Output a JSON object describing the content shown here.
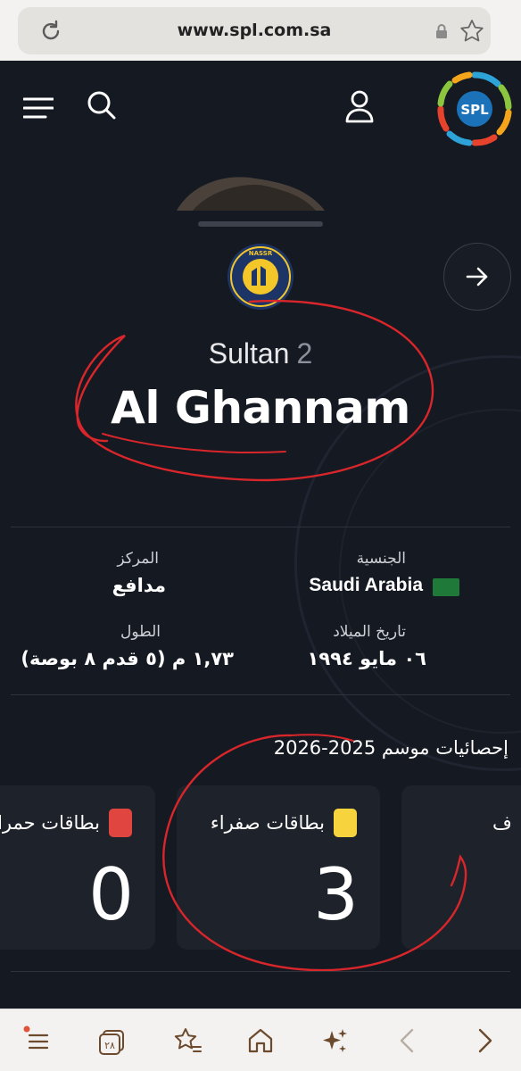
{
  "browser": {
    "url": "www.spl.com.sa"
  },
  "header": {
    "logo_text": "SPL"
  },
  "player": {
    "first_name": "Sultan",
    "shirt_number": "2",
    "last_name": "Al Ghannam"
  },
  "info": {
    "nationality_label": "الجنسية",
    "nationality_value": "Saudi Arabia",
    "position_label": "المركز",
    "position_value": "مدافع",
    "birthdate_label": "تاريخ الميلاد",
    "birthdate_value": "٠٦ مايو ١٩٩٤",
    "height_label": "الطول",
    "height_value": "١,٧٣ م (٥ قدم ٨ بوصة)"
  },
  "stats": {
    "title": "إحصائيات موسم 2025-2026",
    "cards": [
      {
        "label": "بطاقات حمراء",
        "value": "0",
        "chip_color": "#e0453f"
      },
      {
        "label": "بطاقات صفراء",
        "value": "3",
        "chip_color": "#f7d43e"
      },
      {
        "label": "ف",
        "value": ""
      }
    ]
  },
  "colors": {
    "background": "#151922",
    "annotation_red": "#d8262b",
    "club_yellow": "#f3c72a",
    "club_navy": "#1d3566"
  },
  "bottom_nav": {
    "tabs_count": "٢٨"
  }
}
